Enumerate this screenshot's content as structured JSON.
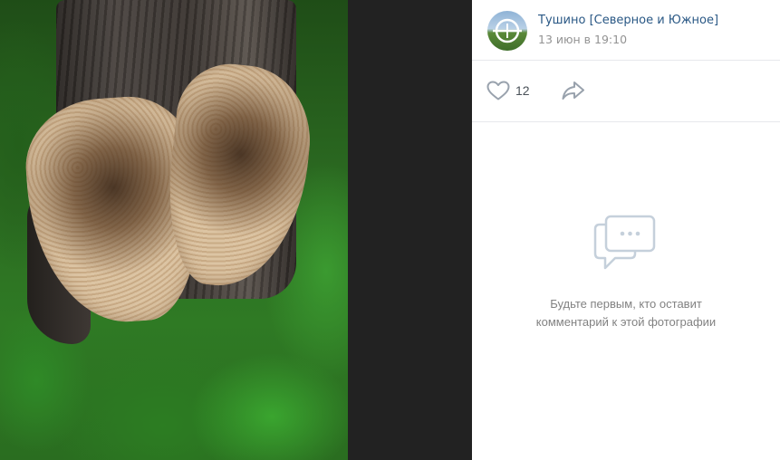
{
  "photo": {
    "subject_icon": "photo-image"
  },
  "post": {
    "avatar_icon": "group-avatar-icon",
    "group_name": "Тушино [Северное и Южное]",
    "date": "13 июн в 19:10"
  },
  "actions": {
    "like_icon": "heart-icon",
    "like_count": "12",
    "share_icon": "share-arrow-icon"
  },
  "comments": {
    "empty_icon": "comments-icon",
    "empty_line1": "Будьте первым, кто оставит",
    "empty_line2": "комментарий к этой фотографии"
  },
  "colors": {
    "link": "#2a5885",
    "muted": "#939393",
    "icon": "#99a2ad",
    "divider": "#e7e8ec",
    "photo_backdrop": "#222222"
  }
}
